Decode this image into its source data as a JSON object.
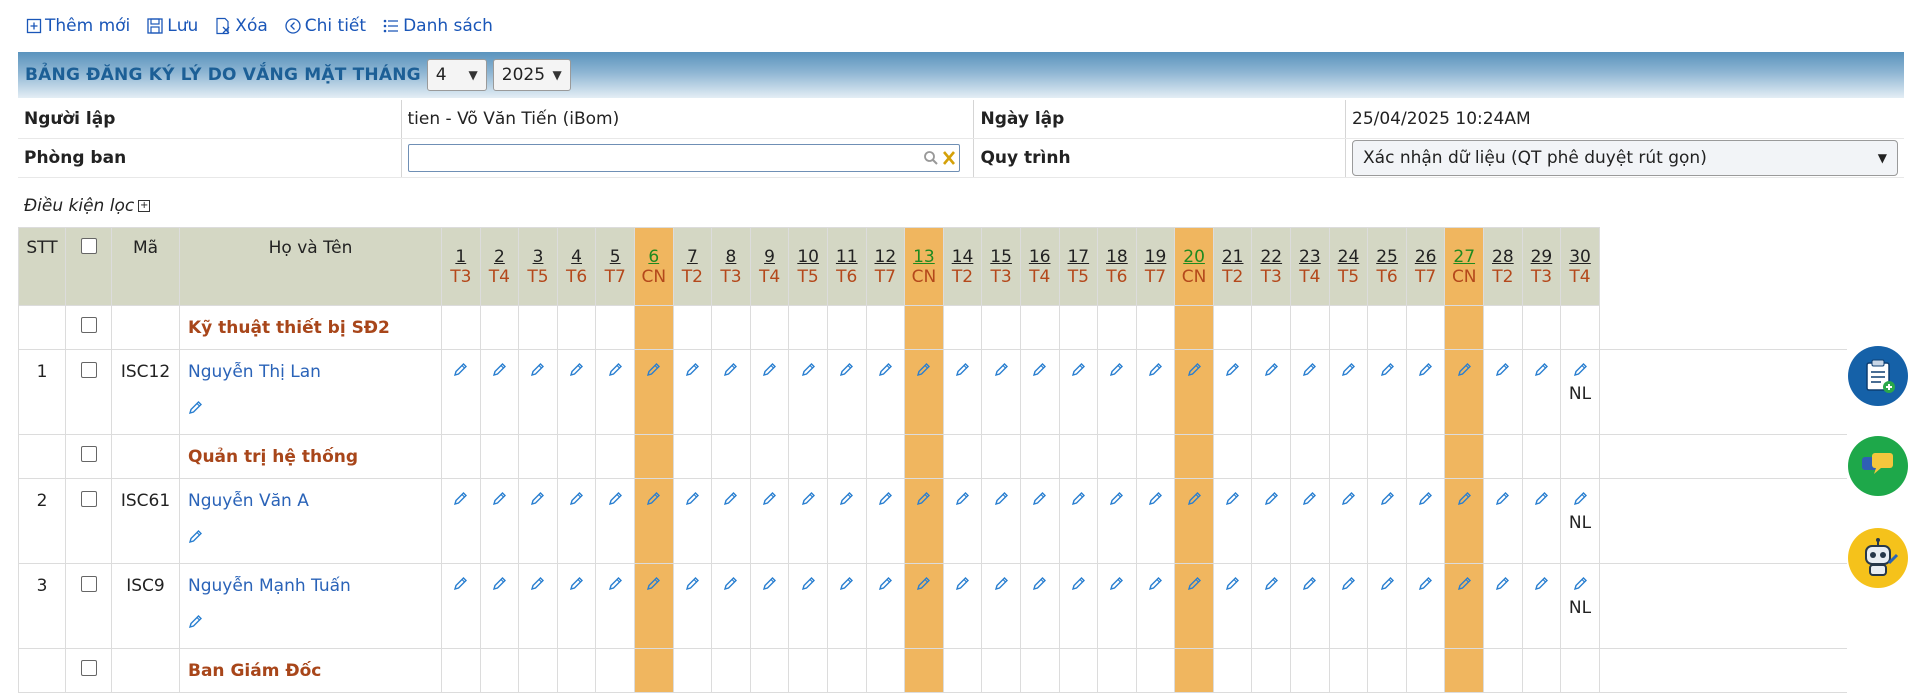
{
  "toolbar": [
    {
      "id": "add",
      "label": "Thêm mới",
      "icon": "add-icon"
    },
    {
      "id": "save",
      "label": "Lưu",
      "icon": "save-icon"
    },
    {
      "id": "delete",
      "label": "Xóa",
      "icon": "delete-icon"
    },
    {
      "id": "detail",
      "label": "Chi tiết",
      "icon": "detail-icon"
    },
    {
      "id": "list",
      "label": "Danh sách",
      "icon": "list-icon"
    }
  ],
  "title": "BẢNG ĐĂNG KÝ LÝ DO VẮNG MẶT THÁNG",
  "month": "4",
  "year": "2025",
  "info": {
    "creator_label": "Người lập",
    "creator_value": "tien - Võ Văn Tiến (iBom)",
    "date_label": "Ngày lập",
    "date_value": "25/04/2025 10:24AM",
    "dept_label": "Phòng ban",
    "dept_value": "",
    "process_label": "Quy trình",
    "process_value": "Xác nhận dữ liệu (QT phê duyệt rút gọn)"
  },
  "filter_label": "Điều kiện lọc",
  "columns": {
    "stt": "STT",
    "code": "Mã",
    "name": "Họ và Tên"
  },
  "days": [
    {
      "d": "1",
      "w": "T3"
    },
    {
      "d": "2",
      "w": "T4"
    },
    {
      "d": "3",
      "w": "T5"
    },
    {
      "d": "4",
      "w": "T6"
    },
    {
      "d": "5",
      "w": "T7"
    },
    {
      "d": "6",
      "w": "CN"
    },
    {
      "d": "7",
      "w": "T2"
    },
    {
      "d": "8",
      "w": "T3"
    },
    {
      "d": "9",
      "w": "T4"
    },
    {
      "d": "10",
      "w": "T5"
    },
    {
      "d": "11",
      "w": "T6"
    },
    {
      "d": "12",
      "w": "T7"
    },
    {
      "d": "13",
      "w": "CN"
    },
    {
      "d": "14",
      "w": "T2"
    },
    {
      "d": "15",
      "w": "T3"
    },
    {
      "d": "16",
      "w": "T4"
    },
    {
      "d": "17",
      "w": "T5"
    },
    {
      "d": "18",
      "w": "T6"
    },
    {
      "d": "19",
      "w": "T7"
    },
    {
      "d": "20",
      "w": "CN"
    },
    {
      "d": "21",
      "w": "T2"
    },
    {
      "d": "22",
      "w": "T3"
    },
    {
      "d": "23",
      "w": "T4"
    },
    {
      "d": "24",
      "w": "T5"
    },
    {
      "d": "25",
      "w": "T6"
    },
    {
      "d": "26",
      "w": "T7"
    },
    {
      "d": "27",
      "w": "CN"
    },
    {
      "d": "28",
      "w": "T2"
    },
    {
      "d": "29",
      "w": "T3"
    },
    {
      "d": "30",
      "w": "T4"
    }
  ],
  "rows": [
    {
      "type": "group",
      "name": "Kỹ thuật thiết bị SĐ2"
    },
    {
      "type": "employee",
      "stt": "1",
      "code": "ISC12",
      "name": "Nguyễn Thị Lan",
      "last_day_note": "NL"
    },
    {
      "type": "group",
      "name": "Quản trị hệ thống"
    },
    {
      "type": "employee",
      "stt": "2",
      "code": "ISC61",
      "name": "Nguyễn Văn A",
      "last_day_note": "NL"
    },
    {
      "type": "employee",
      "stt": "3",
      "code": "ISC9",
      "name": "Nguyễn Mạnh Tuấn",
      "last_day_note": "NL"
    },
    {
      "type": "group",
      "name": "Ban Giám Đốc"
    }
  ],
  "floating_buttons": [
    "clipboard-add-icon",
    "chat-icon",
    "robot-support-icon"
  ],
  "colors": {
    "sunday": "#f0b65f",
    "header_bg": "#d4d7c4",
    "link": "#2a63b8",
    "group": "#a8461a"
  }
}
